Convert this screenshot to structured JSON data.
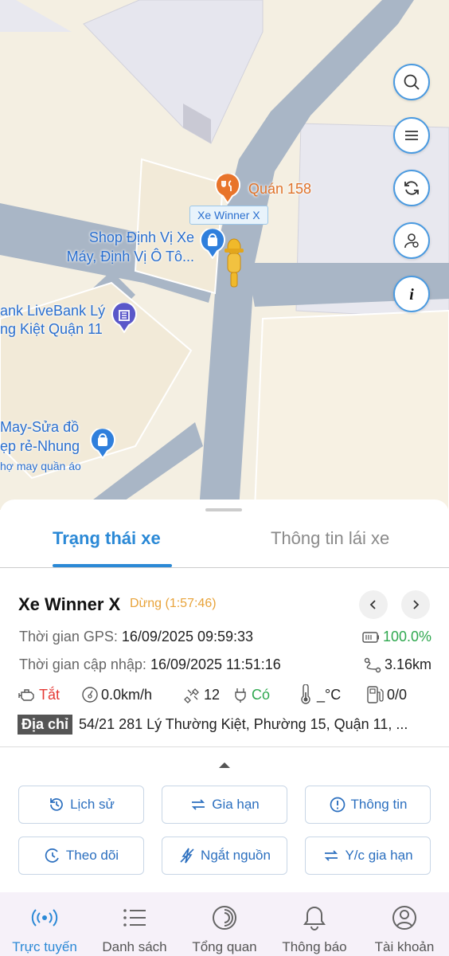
{
  "map": {
    "pois": {
      "quan158": "Quán 158",
      "car_tag": "Xe Winner X",
      "shop_line1": "Shop Định Vị Xe",
      "shop_line2": "Máy, Định Vị Ô Tô...",
      "bank_line1": "ank LiveBank Lý",
      "bank_line2": "ng Kiệt Quận 11",
      "tailor_line1": "May-Sửa đồ",
      "tailor_line2": "ẹp rẻ-Nhung",
      "tailor_line3": "hợ may quần áo"
    },
    "buttons": [
      "search-icon",
      "menu-icon",
      "refresh-icon",
      "person-icon",
      "info-icon"
    ]
  },
  "tabs": {
    "active": "Trạng thái xe",
    "inactive": "Thông tin lái xe"
  },
  "vehicle": {
    "name": "Xe Winner X",
    "status": "Dừng (1:57:46)",
    "gps_label": "Thời gian GPS:",
    "gps_value": "16/09/2025 09:59:33",
    "battery": "100.0%",
    "update_label": "Thời gian cập nhập:",
    "update_value": "16/09/2025 11:51:16",
    "distance": "3.16km",
    "engine": "Tắt",
    "speed": "0.0km/h",
    "satellites": "12",
    "power": "Có",
    "temperature": "_°C",
    "fuel": "0/0",
    "address_label": "Địa chỉ",
    "address": "54/21 281 Lý Thường Kiệt, Phường 15, Quận 11, ..."
  },
  "actions": {
    "history": "Lịch sử",
    "extend": "Gia hạn",
    "info": "Thông tin",
    "track": "Theo dõi",
    "cut_power": "Ngắt nguồn",
    "request_extend": "Y/c gia hạn"
  },
  "bottom_nav": {
    "online": "Trực tuyến",
    "list": "Danh sách",
    "overview": "Tổng quan",
    "notifications": "Thông báo",
    "account": "Tài khoản"
  },
  "colors": {
    "accent": "#2b89d6",
    "status_orange": "#e8a33a",
    "success_green": "#2fa84f",
    "error_red": "#e53935"
  }
}
